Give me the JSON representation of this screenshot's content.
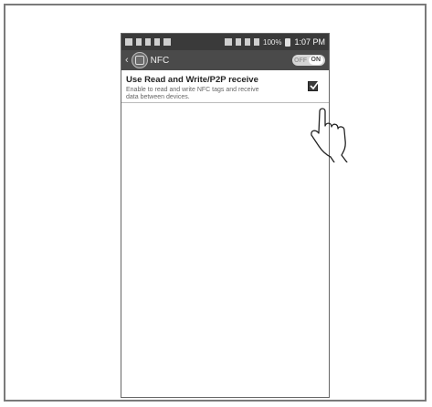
{
  "status_bar": {
    "battery_text": "100%",
    "time": "1:07 PM"
  },
  "action_bar": {
    "title": "NFC",
    "toggle_off_label": "OFF",
    "toggle_on_label": "ON"
  },
  "setting": {
    "title": "Use Read and Write/P2P receive",
    "description": "Enable to read and write NFC tags and receive data between devices.",
    "checked": true
  },
  "icons": [
    "back-icon",
    "nfc-app-icon",
    "checkbox-icon",
    "hand-pointer-icon"
  ],
  "colors": {
    "status_bar": "#3a3a3a",
    "action_bar": "#4a4a4a",
    "checkbox": "#3c3c3c"
  }
}
